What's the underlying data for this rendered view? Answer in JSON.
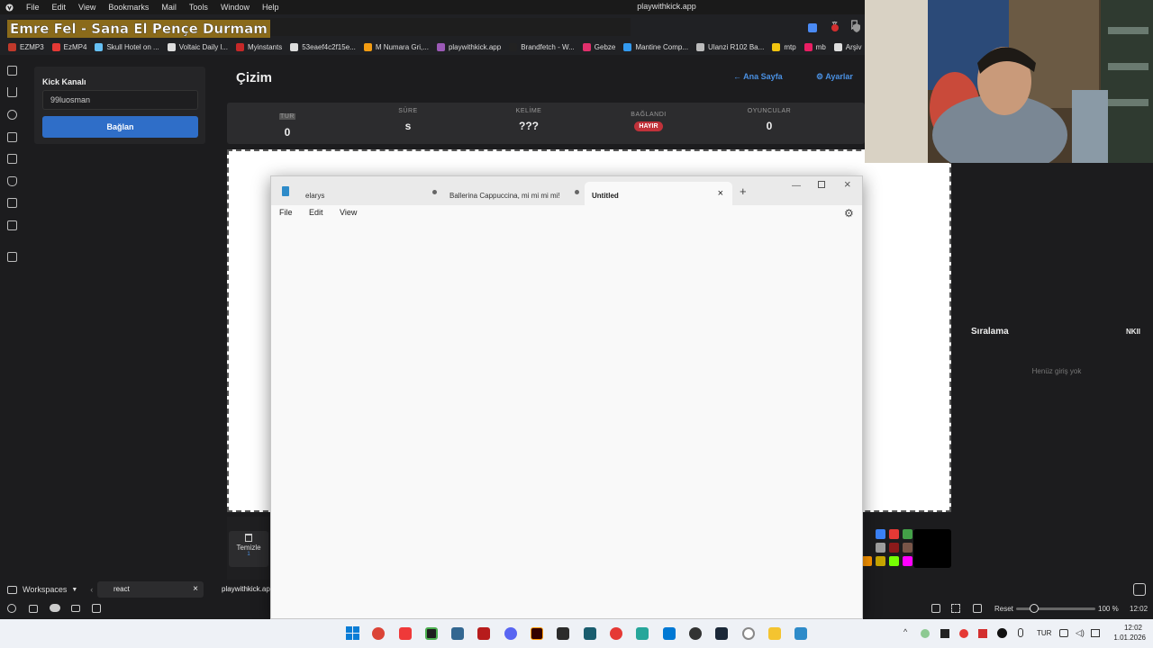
{
  "browser": {
    "menu": [
      "File",
      "Edit",
      "View",
      "Bookmarks",
      "Mail",
      "Tools",
      "Window",
      "Help"
    ],
    "window_title": "playwithkick.app",
    "overlay_title": "Emre Fel - Sana El Pençe Durmam",
    "bookmarks": [
      {
        "label": "EZMP3",
        "color": "#c0392b"
      },
      {
        "label": "EzMP4",
        "color": "#e53935"
      },
      {
        "label": "Skull Hotel on ...",
        "color": "#66c0f4"
      },
      {
        "label": "Voltaic Daily l...",
        "color": "#ddd"
      },
      {
        "label": "Myinstants",
        "color": "#c62828"
      },
      {
        "label": "53eaef4c2f15e...",
        "color": "#ddd"
      },
      {
        "label": "M Numara Gri,...",
        "color": "#f39c12"
      },
      {
        "label": "playwithkick.app",
        "color": "#9b59b6"
      },
      {
        "label": "Brandfetch - W...",
        "color": "#222"
      },
      {
        "label": "Gebze",
        "color": "#e1306c"
      },
      {
        "label": "Mantine Comp...",
        "color": "#339af0"
      },
      {
        "label": "Ulanzi R102 Ba...",
        "color": "#bbb"
      },
      {
        "label": "mtp",
        "color": "#f1c40f"
      },
      {
        "label": "mb",
        "color": "#e91e63"
      },
      {
        "label": "Arşiv",
        "color": "#ddd"
      }
    ]
  },
  "kick": {
    "label": "Kick Kanalı",
    "input_value": "99luosman",
    "connect_button": "Bağlan"
  },
  "main": {
    "title": "Çizim",
    "home_link": "Ana Sayfa",
    "settings_link": "Ayarlar"
  },
  "stats": {
    "round_label": "TUR",
    "round_value": "0",
    "time_label": "SÜRE",
    "time_value": "s",
    "word_label": "KELİME",
    "word_value": "???",
    "connected_label": "BAĞLANDI",
    "connected_value": "HAYIR",
    "players_label": "OYUNCULAR",
    "players_value": "0"
  },
  "tools": {
    "clear_label": "Temizle",
    "clear_hint": "1"
  },
  "ranking": {
    "title": "Sıralama",
    "right_text": "NKII",
    "empty_text": "Henüz giriş yok"
  },
  "palette": [
    "#3b82f6",
    "#e53935",
    "#43a047",
    "#fdd835",
    "#9e9e9e",
    "#8b1a1a",
    "#795548",
    "#7b1fa2",
    "#ff9800",
    "#c6a400",
    "#76ff03",
    "#ff00ff",
    "#ffe0b2"
  ],
  "workspaces": {
    "label": "Workspaces",
    "tab_react": "react",
    "tab_pwk": "playwithkick.app"
  },
  "status_right": {
    "reset_label": "Reset",
    "zoom": "100 %",
    "time_small": "12:02"
  },
  "taskbar": {
    "lang": "TUR",
    "time": "12:02",
    "date": "1.01.2026"
  },
  "notepad": {
    "tabs": [
      "elarys",
      "Ballerina Cappuccina, mi mi mi mi!",
      "Untitled"
    ],
    "menu": [
      "File",
      "Edit",
      "View"
    ]
  }
}
